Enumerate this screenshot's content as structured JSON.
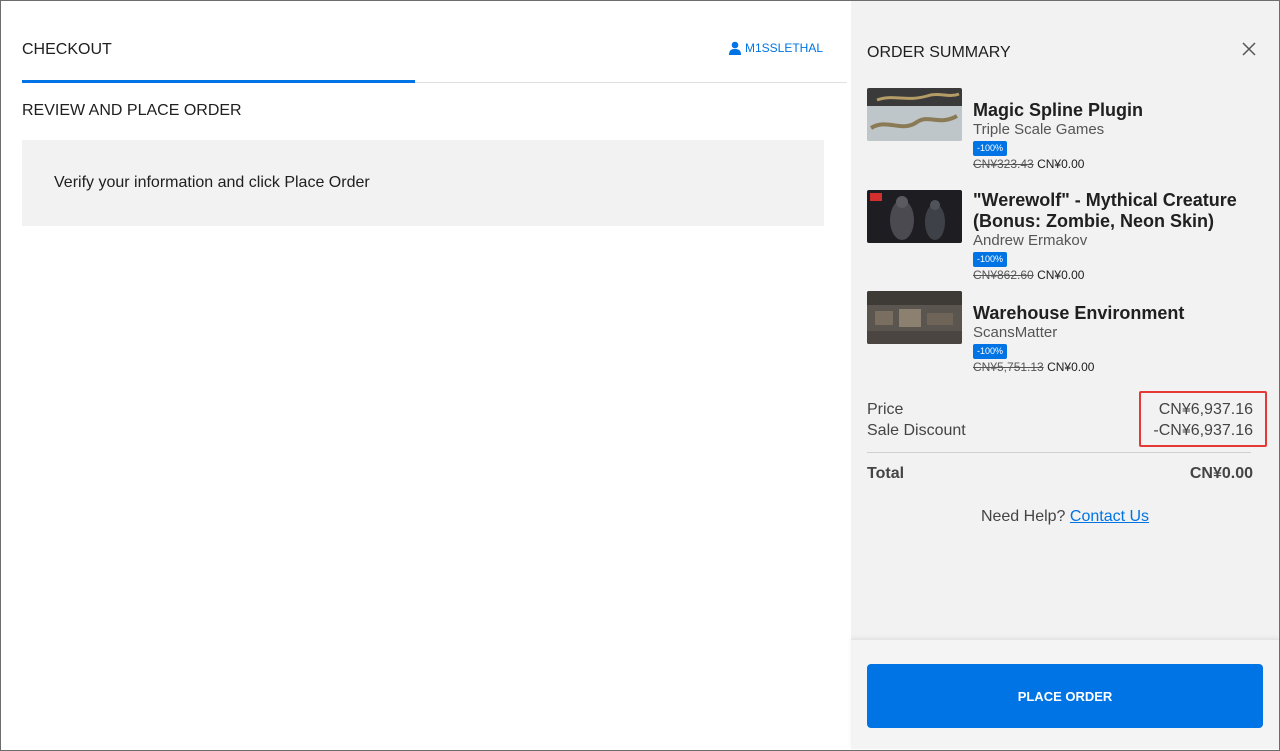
{
  "checkout": {
    "tab_label": "CHECKOUT",
    "username": "M1SSLETHAL",
    "section_title": "REVIEW AND PLACE ORDER",
    "info_message": "Verify your information and click Place Order"
  },
  "summary": {
    "title": "ORDER SUMMARY",
    "items": [
      {
        "title": "Magic Spline Plugin",
        "seller": "Triple Scale Games",
        "badge": "-100%",
        "old_price": "CN¥323.43",
        "new_price": "CN¥0.00",
        "thumb_icon": "spline-thumbnail"
      },
      {
        "title": "\"Werewolf\" - Mythical Creature (Bonus: Zombie, Neon Skin)",
        "seller": "Andrew Ermakov",
        "badge": "-100%",
        "old_price": "CN¥862.60",
        "new_price": "CN¥0.00",
        "thumb_icon": "werewolf-thumbnail"
      },
      {
        "title": "Warehouse Environment",
        "seller": "ScansMatter",
        "badge": "-100%",
        "old_price": "CN¥5,751.13",
        "new_price": "CN¥0.00",
        "thumb_icon": "warehouse-thumbnail"
      }
    ],
    "price_label": "Price",
    "price_value": "CN¥6,937.16",
    "discount_label": "Sale Discount",
    "discount_value": "-CN¥6,937.16",
    "total_label": "Total",
    "total_value": "CN¥0.00",
    "help_text": "Need Help?",
    "help_link": "Contact Us",
    "place_order_label": "PLACE ORDER"
  },
  "colors": {
    "accent": "#0074e4",
    "highlight": "#e53935",
    "panel_bg": "#f2f2f2"
  }
}
